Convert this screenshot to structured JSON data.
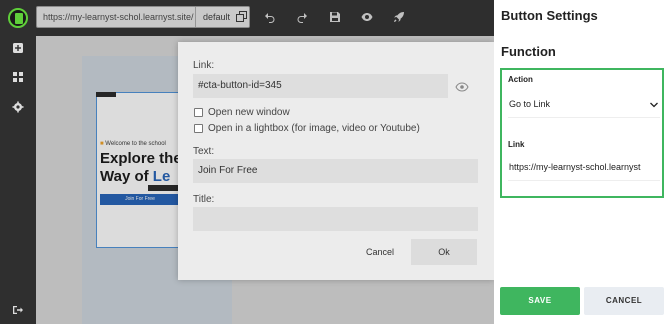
{
  "toolbar": {
    "url": "https://my-learnyst-schol.learnyst.site/",
    "environment": "default",
    "icons": [
      "copy-icon",
      "undo-icon",
      "redo-icon",
      "save-icon",
      "preview-eye-icon",
      "publish-rocket-icon"
    ]
  },
  "sidebar": {
    "icons": [
      "add-block-icon",
      "layout-icon",
      "settings-gear-icon",
      "logout-icon"
    ]
  },
  "preview": {
    "welcome": "Welcome to the school",
    "headline_line1": "Explore the",
    "headline_line2_black": "Way of ",
    "headline_line2_blue": "Le",
    "button": "Join For Free"
  },
  "modal": {
    "link_label": "Link:",
    "link_value": "#cta-button-id=345",
    "open_new_window": "Open new window",
    "open_lightbox": "Open in a lightbox (for image, video or Youtube)",
    "text_label": "Text:",
    "text_value": "Join For Free",
    "title_label": "Title:",
    "title_value": "",
    "cancel": "Cancel",
    "ok": "Ok"
  },
  "panel": {
    "title": "Button Settings",
    "subtitle": "Function",
    "action_label": "Action",
    "action_value": "Go to Link",
    "link_label": "Link",
    "link_value": "https://my-learnyst-schol.learnyst",
    "save": "SAVE",
    "cancel": "CANCEL",
    "accent": "#3fb65f"
  }
}
